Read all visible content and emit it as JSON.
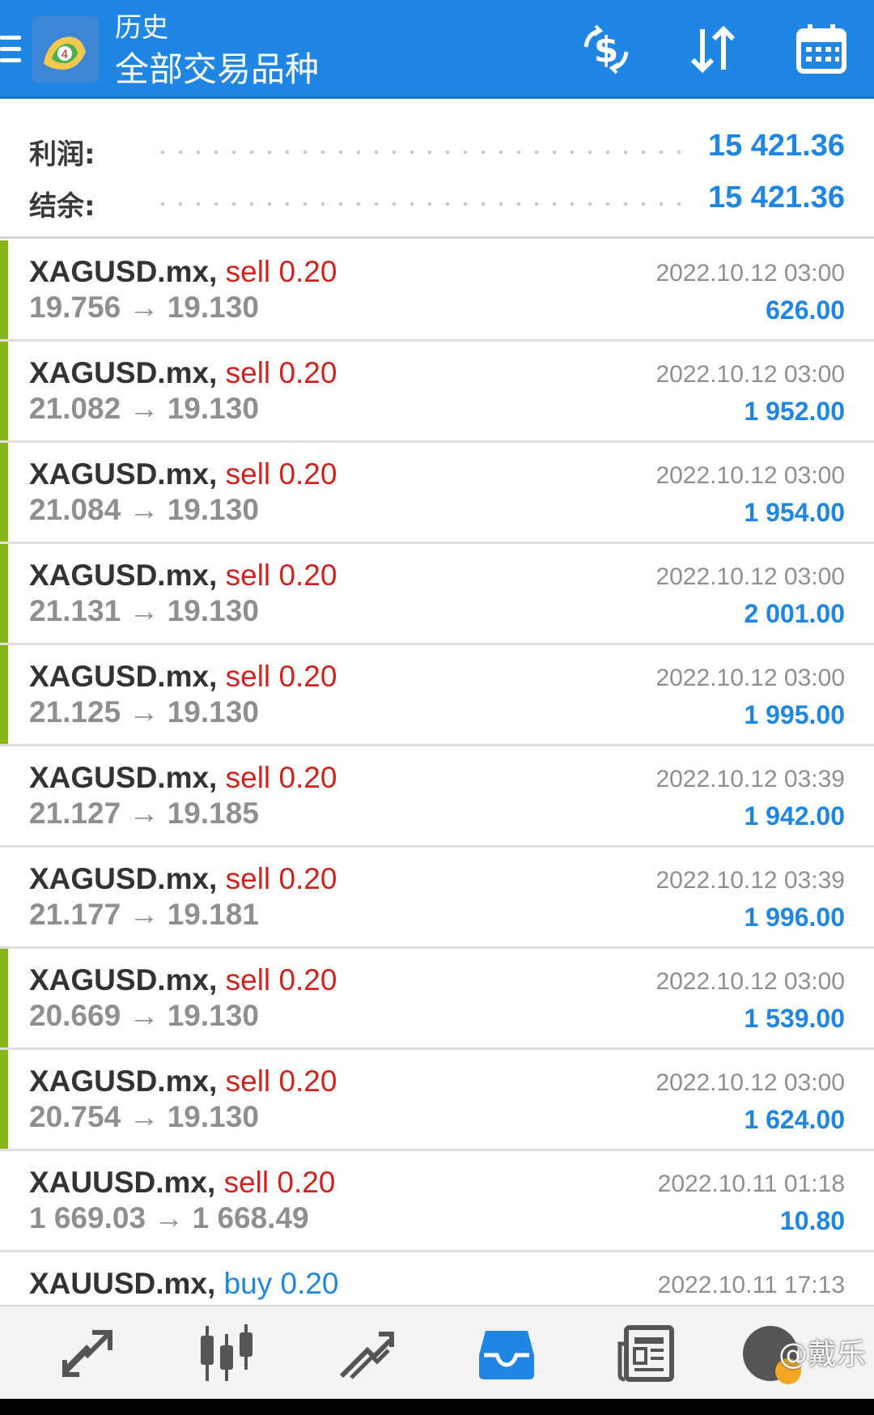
{
  "header": {
    "title": "历史",
    "subtitle": "全部交易品种"
  },
  "summary": {
    "profit_label": "利润:",
    "profit_value": "15 421.36",
    "balance_label": "结余:",
    "balance_value": "15 421.36"
  },
  "trades": [
    {
      "symbol": "XAGUSD.mx,",
      "side": "sell",
      "volume": "0.20",
      "prices": "19.756 → 19.130",
      "time": "2022.10.12 03:00",
      "profit": "626.00",
      "marked": true
    },
    {
      "symbol": "XAGUSD.mx,",
      "side": "sell",
      "volume": "0.20",
      "prices": "21.082 → 19.130",
      "time": "2022.10.12 03:00",
      "profit": "1 952.00",
      "marked": true
    },
    {
      "symbol": "XAGUSD.mx,",
      "side": "sell",
      "volume": "0.20",
      "prices": "21.084 → 19.130",
      "time": "2022.10.12 03:00",
      "profit": "1 954.00",
      "marked": true
    },
    {
      "symbol": "XAGUSD.mx,",
      "side": "sell",
      "volume": "0.20",
      "prices": "21.131 → 19.130",
      "time": "2022.10.12 03:00",
      "profit": "2 001.00",
      "marked": true
    },
    {
      "symbol": "XAGUSD.mx,",
      "side": "sell",
      "volume": "0.20",
      "prices": "21.125 → 19.130",
      "time": "2022.10.12 03:00",
      "profit": "1 995.00",
      "marked": true
    },
    {
      "symbol": "XAGUSD.mx,",
      "side": "sell",
      "volume": "0.20",
      "prices": "21.127 → 19.185",
      "time": "2022.10.12 03:39",
      "profit": "1 942.00",
      "marked": false
    },
    {
      "symbol": "XAGUSD.mx,",
      "side": "sell",
      "volume": "0.20",
      "prices": "21.177 → 19.181",
      "time": "2022.10.12 03:39",
      "profit": "1 996.00",
      "marked": false
    },
    {
      "symbol": "XAGUSD.mx,",
      "side": "sell",
      "volume": "0.20",
      "prices": "20.669 → 19.130",
      "time": "2022.10.12 03:00",
      "profit": "1 539.00",
      "marked": true
    },
    {
      "symbol": "XAGUSD.mx,",
      "side": "sell",
      "volume": "0.20",
      "prices": "20.754 → 19.130",
      "time": "2022.10.12 03:00",
      "profit": "1 624.00",
      "marked": true
    },
    {
      "symbol": "XAUUSD.mx,",
      "side": "sell",
      "volume": "0.20",
      "prices": "1 669.03 → 1 668.49",
      "time": "2022.10.11 01:18",
      "profit": "10.80",
      "marked": false
    },
    {
      "symbol": "XAUUSD.mx,",
      "side": "buy",
      "volume": "0.20",
      "prices": "",
      "time": "2022.10.11 17:13",
      "profit": "",
      "marked": false
    }
  ],
  "toolbar_icons": [
    "currency-exchange-icon",
    "sort-icon",
    "calendar-icon"
  ],
  "nav_icons": [
    "quotes-icon",
    "chart-icon",
    "trade-icon",
    "history-icon",
    "news-icon",
    "messages-icon"
  ],
  "active_nav": "history-icon",
  "watermark": "@戴乐",
  "colors": {
    "appbar": "#1f87e3",
    "sell": "#d0231d",
    "buy": "#1f87e3",
    "profit": "#1f87e3",
    "marker": "#86b51a"
  }
}
